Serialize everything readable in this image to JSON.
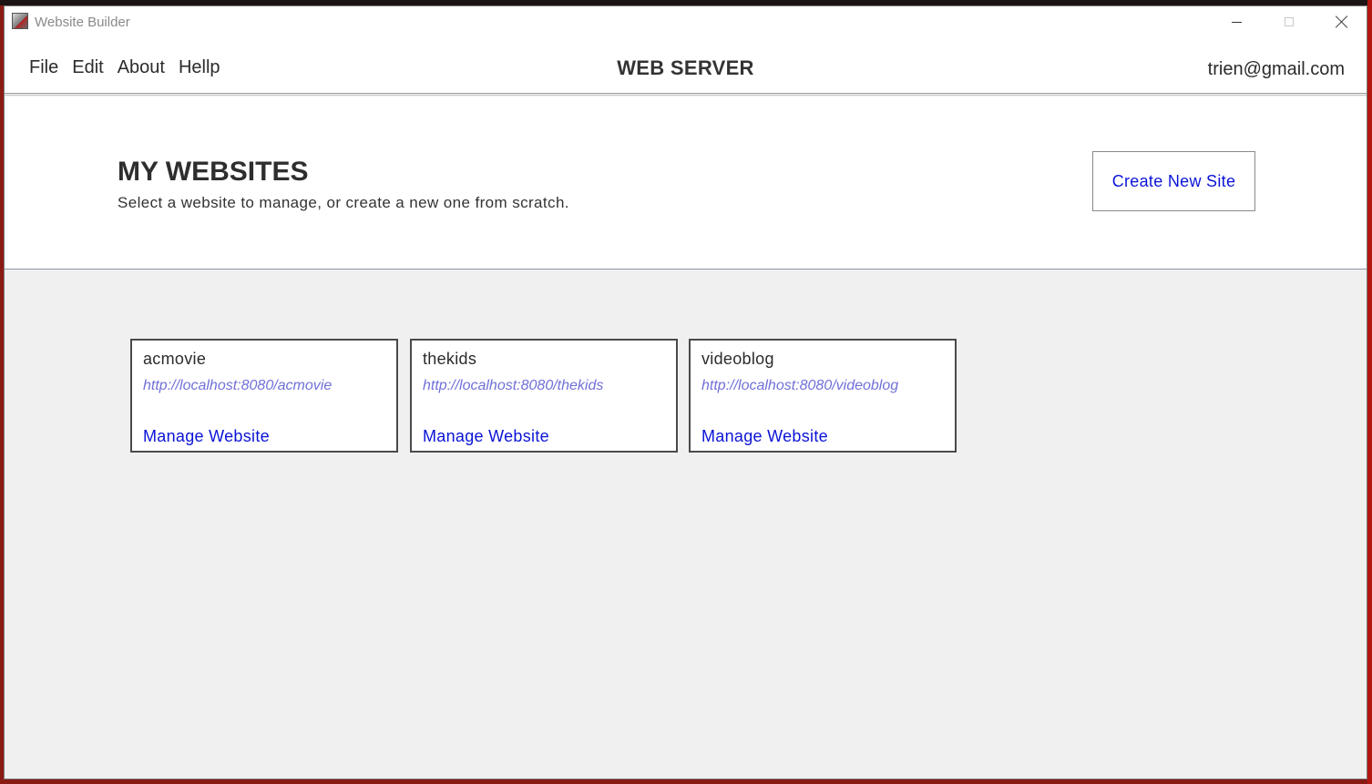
{
  "window": {
    "title": "Website Builder",
    "icon": "app-icon"
  },
  "menubar": {
    "items": [
      "File",
      "Edit",
      "About",
      "Hellp"
    ],
    "brand": "WEB SERVER",
    "user_email": "trien@gmail.com"
  },
  "header": {
    "title": "MY WEBSITES",
    "subtitle": "Select a website to manage, or create a new one from scratch.",
    "create_button": "Create New Site"
  },
  "sites": [
    {
      "name": "acmovie",
      "url": "http://localhost:8080/acmovie",
      "action": "Manage Website"
    },
    {
      "name": "thekids",
      "url": "http://localhost:8080/thekids",
      "action": "Manage Website"
    },
    {
      "name": "videoblog",
      "url": "http://localhost:8080/videoblog",
      "action": "Manage Website"
    }
  ],
  "colors": {
    "link": "#0b14d6",
    "url": "#7070d8",
    "panel_bg": "#f0f0f0"
  }
}
